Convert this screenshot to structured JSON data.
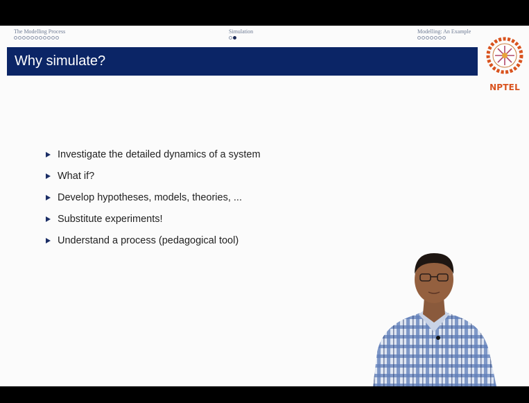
{
  "navigation": {
    "sections": [
      {
        "label": "The Modelling Process",
        "dots": 11,
        "filled": 0
      },
      {
        "label": "Simulation",
        "dots": 2,
        "filled": 1
      },
      {
        "label": "Modelling: An Example",
        "dots": 7,
        "filled": 0
      }
    ]
  },
  "slide": {
    "title": "Why simulate?",
    "bullets": [
      "Investigate the detailed dynamics of a system",
      "What if?",
      "Develop hypotheses, models, theories, ...",
      "Substitute experiments!",
      "Understand a process (pedagogical tool)"
    ]
  },
  "logo": {
    "text": "NPTEL",
    "color": "#d9531e"
  },
  "colors": {
    "titlebar": "#0b2566",
    "bullet_marker": "#1b2e66"
  }
}
